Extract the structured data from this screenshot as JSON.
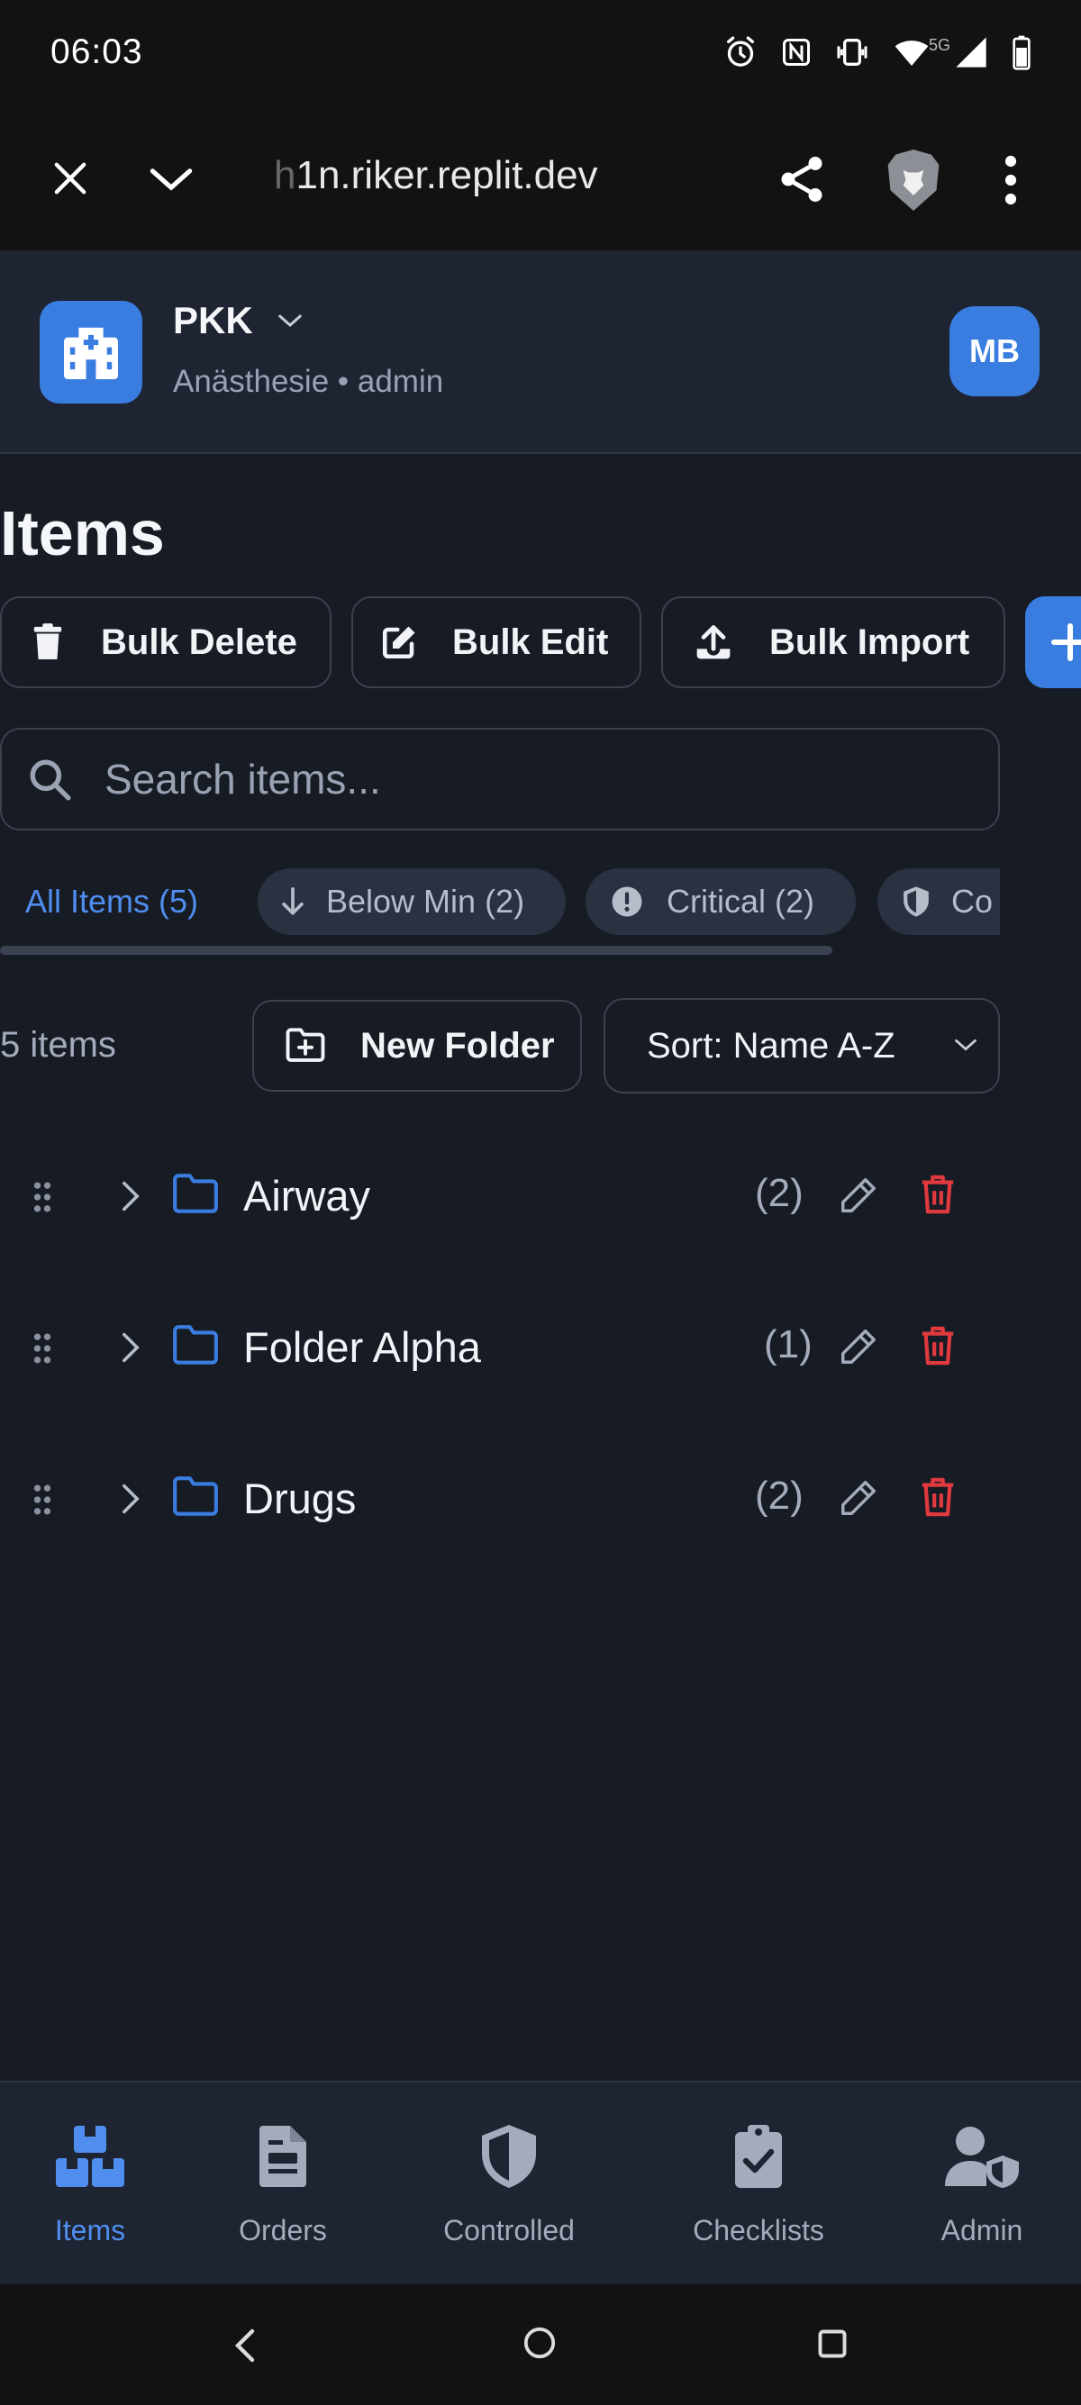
{
  "status_bar": {
    "time": "06:03",
    "network": "5G"
  },
  "browser": {
    "url_prefix": "h",
    "url_main": "1n.riker.replit.dev"
  },
  "header": {
    "hospital": "PKK",
    "subtitle": "Anästhesie • admin",
    "avatar_initials": "MB"
  },
  "page": {
    "title": "Items"
  },
  "toolbar": {
    "bulk_delete": "Bulk Delete",
    "bulk_edit": "Bulk Edit",
    "bulk_import": "Bulk Import"
  },
  "search": {
    "placeholder": "Search items..."
  },
  "filters": {
    "all": "All Items (5)",
    "below_min": "Below Min (2)",
    "critical": "Critical (2)",
    "controlled": "Co"
  },
  "list_controls": {
    "count": "5 items",
    "new_folder": "New Folder",
    "sort_selected": "Sort: Name A-Z"
  },
  "folders": [
    {
      "name": "Airway",
      "count": "(2)"
    },
    {
      "name": "Folder Alpha",
      "count": "(1)"
    },
    {
      "name": "Drugs",
      "count": "(2)"
    }
  ],
  "bottom_nav": [
    {
      "label": "Items",
      "icon": "boxes-icon",
      "active": true
    },
    {
      "label": "Orders",
      "icon": "document-icon",
      "active": false
    },
    {
      "label": "Controlled",
      "icon": "shield-icon",
      "active": false
    },
    {
      "label": "Checklists",
      "icon": "clipboard-check-icon",
      "active": false
    },
    {
      "label": "Admin",
      "icon": "user-shield-icon",
      "active": false
    }
  ],
  "colors": {
    "accent": "#3a7de0",
    "danger": "#e0393e",
    "background": "#171b24",
    "surface": "#1e2431"
  }
}
